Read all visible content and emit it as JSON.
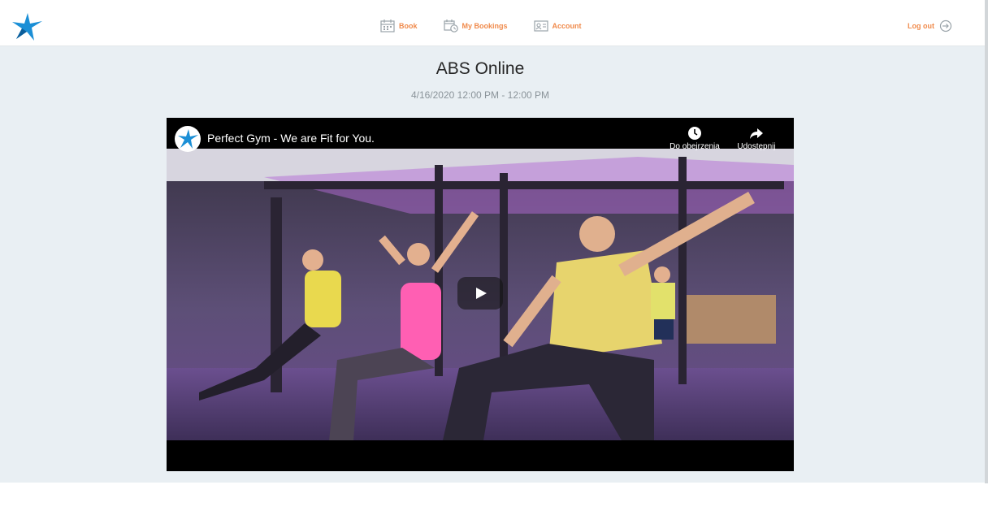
{
  "nav": {
    "book": "Book",
    "my_bookings": "My Bookings",
    "account": "Account",
    "logout": "Log out"
  },
  "page": {
    "title": "ABS Online",
    "date": "4/16/2020 12:00 PM - 12:00 PM"
  },
  "video": {
    "title": "Perfect Gym - We are Fit for You.",
    "watch_later": "Do obejrzenia",
    "share": "Udostępnij"
  },
  "colors": {
    "accent": "#f08a4b",
    "brand_blue": "#1b8fd6",
    "background": "#e9eff3"
  }
}
